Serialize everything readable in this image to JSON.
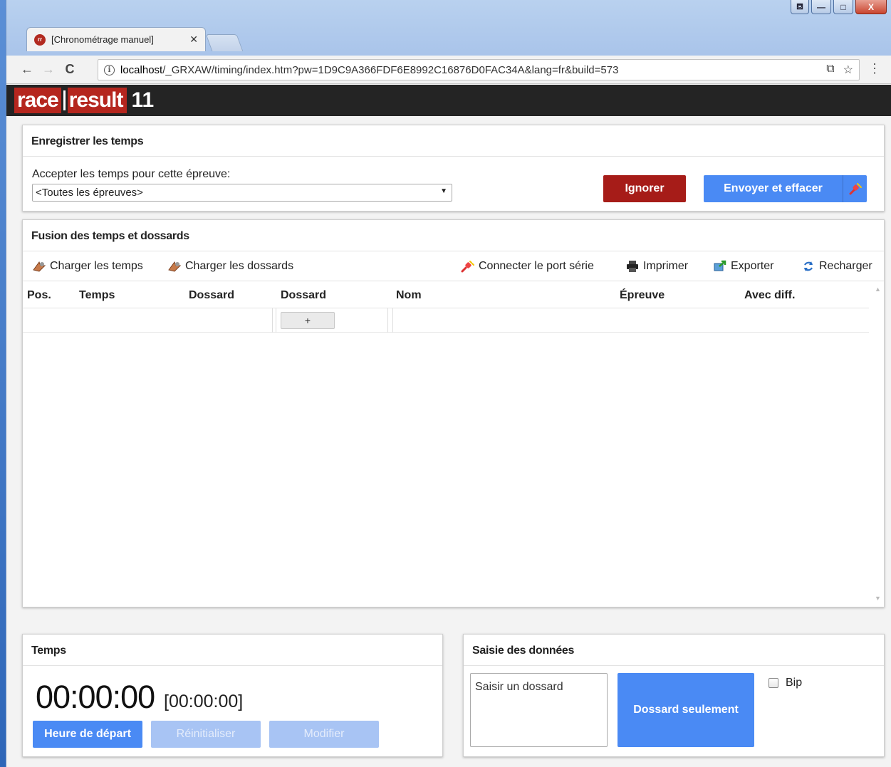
{
  "browser": {
    "tab_title": "[Chronométrage manuel]",
    "tab_close": "✕",
    "favicon_text": "rr",
    "url_host": "localhost",
    "url_path": "/_GRXAW/timing/index.htm?pw=1D9C9A366FDF6E8992C16876D0FAC34A&lang=fr&build=573",
    "back": "←",
    "forward": "→",
    "reload": "C",
    "translate_icon": "⧉",
    "star_icon": "☆",
    "menu_icon": "⋮",
    "window_min": "—",
    "window_max": "□",
    "window_close": "X",
    "window_user": "⛾"
  },
  "logo": {
    "race": "race",
    "result": "result",
    "version": "11"
  },
  "record": {
    "heading": "Enregistrer les temps",
    "accept_label": "Accepter les temps pour cette épreuve:",
    "select_value": "<Toutes les épreuves>",
    "ignore_label": "Ignorer",
    "send_label": "Envoyer et effacer"
  },
  "merge": {
    "heading": "Fusion des temps et dossards",
    "actions": {
      "load_times": "Charger les temps",
      "load_bibs": "Charger les dossards",
      "connect_serial": "Connecter le port série",
      "print": "Imprimer",
      "export": "Exporter",
      "reload": "Recharger"
    },
    "columns": [
      "Pos.",
      "Temps",
      "Dossard",
      "Dossard",
      "Nom",
      "Épreuve",
      "Avec diff."
    ],
    "add_button": "+"
  },
  "time": {
    "heading": "Temps",
    "clock": "00:00:00",
    "clock_secondary": "[00:00:00]",
    "start_label": "Heure de départ",
    "reset_label": "Réinitialiser",
    "modify_label": "Modifier"
  },
  "entry": {
    "heading": "Saisie des données",
    "bib_placeholder": "Saisir un dossard",
    "bib_only_label": "Dossard seulement",
    "bip_label": "Bip",
    "bip_checked": false
  },
  "colors": {
    "accent_blue": "#4a8af4",
    "ignore_red": "#a61c18",
    "brand_red": "#b5261e",
    "header_dark": "#242424"
  }
}
